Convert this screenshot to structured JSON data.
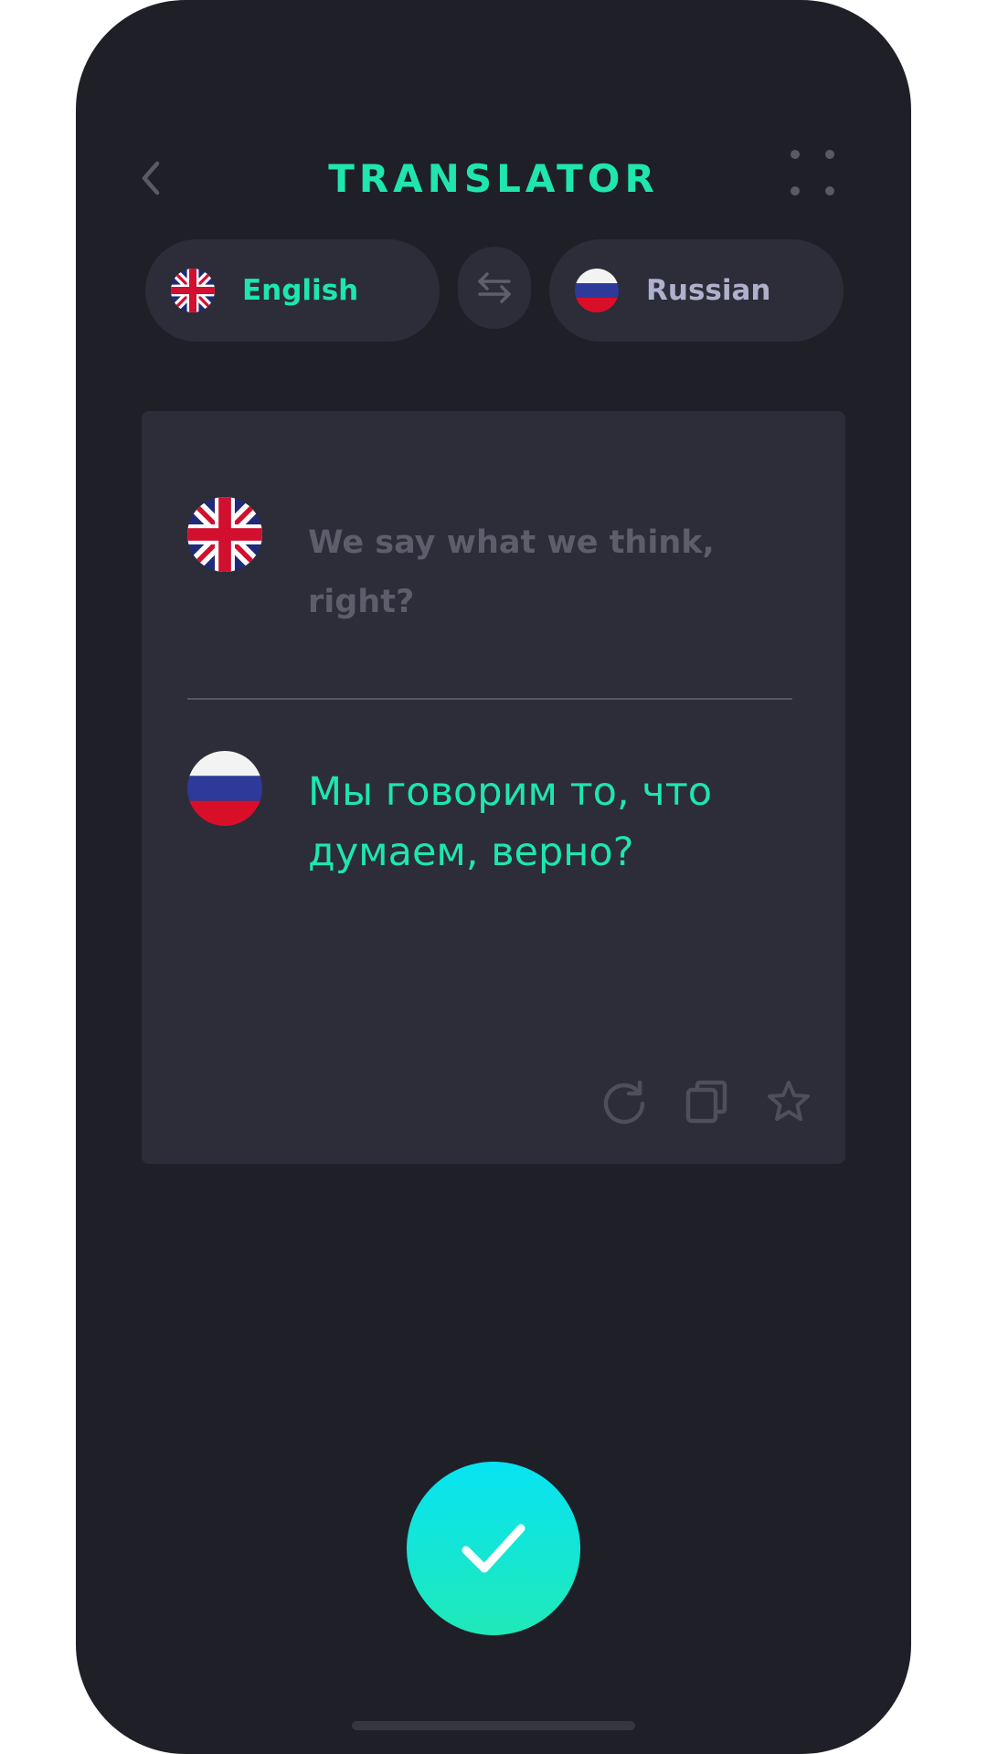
{
  "header": {
    "title": "TRANSLATOR",
    "back_icon": "chevron-left-icon",
    "menu_icon": "grid-dots-icon"
  },
  "languages": {
    "source": {
      "label": "English",
      "flag": "uk-flag-icon"
    },
    "target": {
      "label": "Russian",
      "flag": "russia-flag-icon"
    },
    "swap_icon": "swap-arrows-icon"
  },
  "translation": {
    "source_text": "We say what we think, right?",
    "target_text": "Мы говорим то, что думаем, верно?"
  },
  "card_actions": {
    "refresh_icon": "refresh-icon",
    "copy_icon": "copy-icon",
    "favorite_icon": "star-icon"
  },
  "confirm": {
    "icon": "check-icon"
  },
  "colors": {
    "accent": "#1ee6ae",
    "background": "#1f1f27",
    "surface": "#2c2d38",
    "muted_text": "#5d5d6c",
    "gradient_top": "#07e3f3",
    "gradient_bottom": "#20e9b8"
  }
}
